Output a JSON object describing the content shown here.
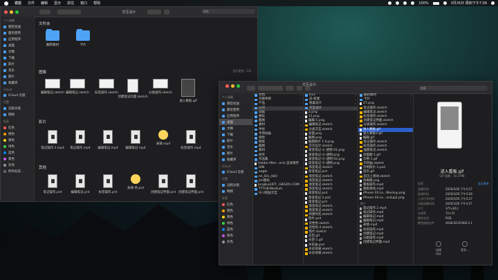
{
  "menubar": {
    "app": "访达",
    "items": [
      "文件",
      "编辑",
      "显示",
      "前往",
      "窗口",
      "帮助"
    ],
    "battery": "100%",
    "datetime": "3月26日 周四下午7:09"
  },
  "win1": {
    "title": "交互设计",
    "search_placeholder": "搜索",
    "sidebar": {
      "fav_header": "个人收藏",
      "favs": [
        "隔空投送",
        "最近使用",
        "应用程序",
        "桌面",
        "文稿",
        "下载",
        "影片",
        "音乐",
        "图片",
        "收藏夹"
      ],
      "icloud_header": "iCloud",
      "icloud": [
        "iCloud 云盘"
      ],
      "loc_header": "位置",
      "locs": [
        "远程光盘",
        "网络"
      ],
      "tags_header": "标签",
      "tags": [
        "红色",
        "橙色",
        "黄色",
        "绿色",
        "蓝色",
        "紫色",
        "灰色",
        "所有标签..."
      ],
      "tag_colors": [
        "#ff5b57",
        "#ff9f0a",
        "#ffd60a",
        "#32d74b",
        "#0a84ff",
        "#bf5af2",
        "#98989d"
      ]
    },
    "sections": {
      "folders_title": "文件夹",
      "folders": [
        "翻转素材",
        "卡片"
      ],
      "images_title": "图像",
      "images": [
        "编辑笔记.sketch",
        "编辑笔记.sketch",
        "标签操作.sketch",
        "创建笔记页面.sketch",
        "分类操作.sketch",
        "进入看板.gif"
      ],
      "show_more": "显示更多（13）",
      "movies_title": "影片",
      "movies": [
        "笔记操作 2.mp4",
        "笔记操作.mp4",
        "编辑笔记.mp4",
        "编辑笔记.mp4",
        "表情.mp4",
        "标签操作.mp4"
      ],
      "other_title": "其他",
      "other": [
        "笔记操作.prd",
        "编辑笔记.prd",
        "标签操作.prd",
        "表情-色.prd",
        "创建笔记界面.prd",
        "创建笔记界面.prd"
      ]
    }
  },
  "win2": {
    "title": "交互设计",
    "search_placeholder": "搜索",
    "sidebar": {
      "fav_header": "个人收藏",
      "favs": [
        "隔空投送",
        "最近使用",
        "应用程序",
        "桌面",
        "文稿",
        "下载",
        "影片",
        "音乐",
        "图片",
        "收藏夹"
      ],
      "icloud_header": "iCloud",
      "icloud": [
        "iCloud 云盘"
      ],
      "loc_header": "位置",
      "locs": [
        "远程光盘",
        "网络"
      ],
      "tags_header": "标签",
      "tags": [
        "红色",
        "橙色",
        "黄色",
        "绿色",
        "蓝色",
        "紫色",
        "灰色"
      ],
      "tag_colors": [
        "#ff5b57",
        "#ff9f0a",
        "#ffd60a",
        "#32d74b",
        "#0a84ff",
        "#bf5af2",
        "#98989d"
      ]
    },
    "col1": [
      "文档",
      "交换项目",
      "产品",
      "公司",
      "动画",
      "图标",
      "截图",
      "素材",
      "手绘",
      "手持动画",
      "视觉",
      "壁纸",
      "截图",
      "素材",
      "研究",
      "作品集",
      "Adobe After...ects 自动保存",
      "DIN",
      "eagle",
      "en_Din_(b0)",
      "jim图标",
      "Jengkuo(KIT...GKAZA).COM",
      "TTTGB-Medium",
      "UI-2图层交互"
    ],
    "col2": [
      "b13",
      "白-新建",
      "我喜设计",
      "交互设计",
      "2.png",
      "11.png",
      "编辑 5.png",
      "编辑笔记.sketch",
      "分类交互.sketch",
      "封面.png",
      "截图.png",
      "截图照片 1 6.png",
      "交叉设计.sketch",
      "渐变笔记-小 透明-01.png",
      "渐变笔记-小-透明.png",
      "渐变笔记-小-透明-02.png",
      "渐变笔记-小-透明.png",
      "渐变笔记.sketch",
      "渐变笔记.prd",
      "渐变笔记.sketch",
      "渐变笔记.sketch",
      "渐变笔记.sketch",
      "渐变笔记.sketch",
      "渐变笔记.psd",
      "渐变笔记 2.psd",
      "渐变笔记.prd",
      "渐变笔记.sketch",
      "渐变笔记.sketch",
      "新建时无.sketch",
      "照片.psd",
      "灵性色.sketch",
      "灵性色-2.sketch",
      "照片.sketch",
      "天空.gif",
      "天空-1.gif",
      "水彩画.psd",
      "水彩效果.sketch",
      "水彩效果.sketch"
    ],
    "col3": [
      "翻转素材",
      "卡片",
      "27.png",
      "笔记操作.sketch",
      "编辑笔记.sketch",
      "标签操作.sketch",
      "创建笔记界面.sketch",
      "分类操作.sketch",
      "进入看板.gif",
      "进入看板2.gif",
      "编辑.gif",
      "笔记操作.sketch",
      "标签操作.sketch",
      "插图笔记.sketch",
      "封面图-1.gif",
      "示例-1.gif",
      "示例画.sketch",
      "示例照片-1.psd",
      "首页.gif",
      "首页上滑动.sketch",
      "仿真图.png",
      "看板操作.mp4",
      "看板滑动.mp4",
      "iPhone XS Lo...Mockup.png",
      "iPhone XS Lo...ockup2.png"
    ],
    "col3_movies_header": "影片",
    "col3_movies": [
      "笔记操作 2.mp4",
      "笔记操作.mp4",
      "编辑笔记.mp4",
      "编辑笔记.mp4",
      "表情.mp4",
      "标签操作.mp4",
      "创建笔记.mp4",
      "分类操作.mp4",
      "创建笔记界面.mp4"
    ],
    "col3_active": "进入看板.gif",
    "preview": {
      "title": "进入看板.gif",
      "subtitle": "GIF 图像 - 10.4 MB",
      "info_header": "信息",
      "info": [
        [
          "创建时间",
          "2020/3/26 下午3:27"
        ],
        [
          "修改时间",
          "2020/3/26 下午3:28"
        ],
        [
          "上次打开时间",
          "2020/3/26 下午3:27"
        ],
        [
          "内容创建时间",
          "2020/3/26 下午3:27"
        ],
        [
          "尺寸",
          "375×812"
        ],
        [
          "分辨率",
          "72×72"
        ],
        [
          "颜色空间",
          "RGB"
        ],
        [
          "颜色描述文件",
          "sRGB IEC61966-2.1"
        ]
      ],
      "show_more": "显示更多",
      "btn1": "创建 PDF",
      "btn2": "更多..."
    }
  }
}
